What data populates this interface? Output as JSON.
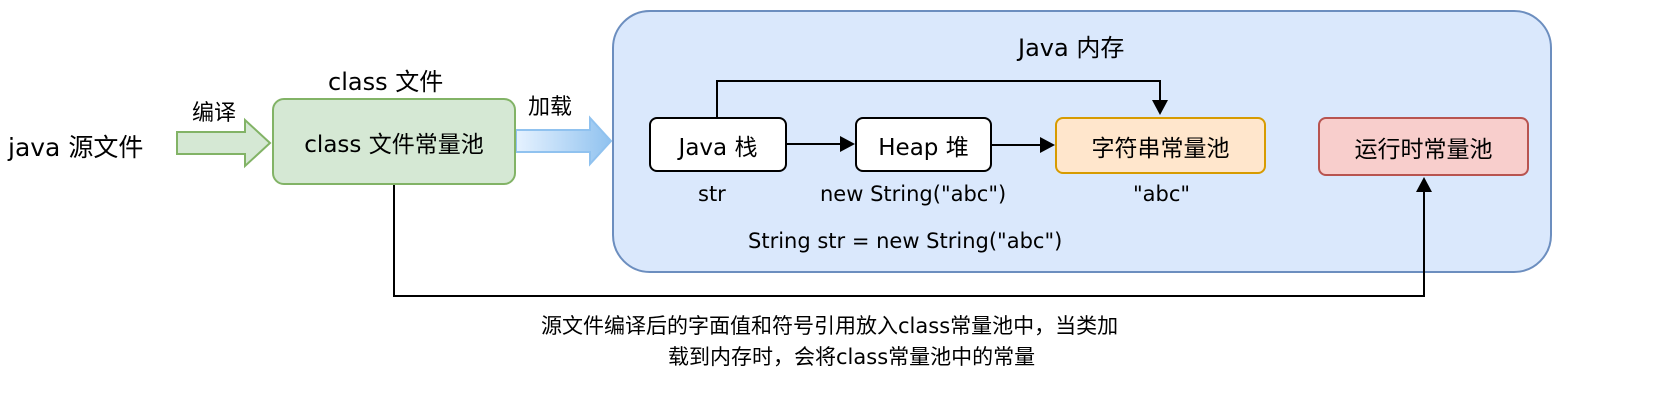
{
  "diagram": {
    "source_label": "java 源文件",
    "compile_label": "编译",
    "class_file_title": "class 文件",
    "class_pool_label": "class 文件常量池",
    "load_label": "加载",
    "java_memory_title": "Java 内存",
    "java_stack_label": "Java 栈",
    "heap_label": "Heap 堆",
    "string_pool_label": "字符串常量池",
    "runtime_pool_label": "运行时常量池",
    "stack_var_label": "str",
    "heap_obj_label": "new String(\"abc\")",
    "pool_literal_label": "\"abc\"",
    "code_statement": "String str = new String(\"abc\")",
    "note_line1": "源文件编译后的字面值和符号引用放入class常量池中，当类加",
    "note_line2": "载到内存时，会将class常量池中的常量"
  },
  "colors": {
    "memory_fill": "#dae8fc",
    "memory_border": "#6c8ebf",
    "class_fill": "#d5e8d4",
    "class_border": "#82b366",
    "string_pool_fill": "#ffe6cc",
    "string_pool_border": "#d79b00",
    "runtime_fill": "#f8cecc",
    "runtime_border": "#b85450",
    "load_arrow_start": "#e6f2ff",
    "load_arrow_end": "#90c2ef"
  }
}
